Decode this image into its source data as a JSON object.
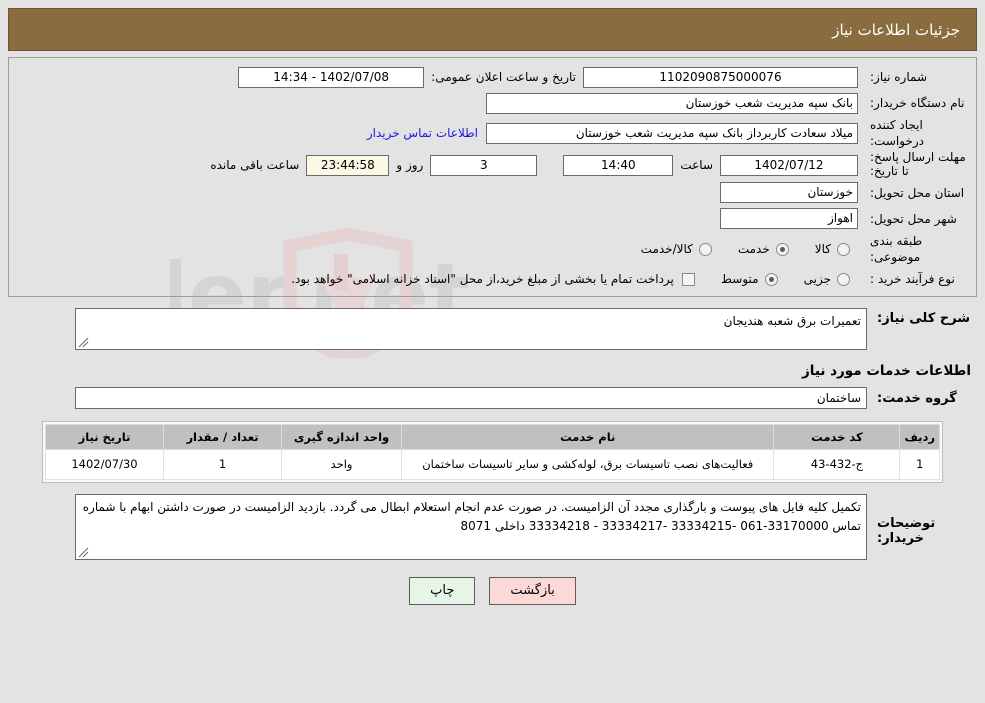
{
  "header": {
    "title": "جزئیات اطلاعات نیاز"
  },
  "form": {
    "need_number_label": "شماره نیاز:",
    "need_number_value": "1102090875000076",
    "public_announce_label": "تاریخ و ساعت اعلان عمومی:",
    "public_announce_value": "1402/07/08 - 14:34",
    "buyer_org_label": "نام دستگاه خریدار:",
    "buyer_org_value": "بانک سپه مدیریت شعب خوزستان",
    "creator_label": "ایجاد کننده درخواست:",
    "creator_value": "میلاد سعادت کاربرداز بانک سپه مدیریت شعب خوزستان",
    "buyer_contact_link": "اطلاعات تماس خریدار",
    "deadline_label": "مهلت ارسال پاسخ: تا تاریخ:",
    "deadline_date": "1402/07/12",
    "deadline_hour_label": "ساعت",
    "deadline_hour_value": "14:40",
    "remaining_days_value": "3",
    "remaining_days_text": "روز و",
    "remaining_time_value": "23:44:58",
    "remaining_suffix": "ساعت باقی مانده",
    "province_label": "استان محل تحویل:",
    "province_value": "خوزستان",
    "city_label": "شهر محل تحویل:",
    "city_value": "اهواز",
    "category_label": "طبقه بندی موضوعی:",
    "category_options": [
      {
        "label": "کالا",
        "selected": false
      },
      {
        "label": "خدمت",
        "selected": true
      },
      {
        "label": "کالا/خدمت",
        "selected": false
      }
    ],
    "process_label": "نوع فرآیند خرید :",
    "process_options": [
      {
        "label": "جزیی",
        "selected": false
      },
      {
        "label": "متوسط",
        "selected": true
      }
    ],
    "treasury_checkbox_checked": false,
    "treasury_note": "پرداخت تمام یا بخشی از مبلغ خرید،از محل \"اسناد خزانه اسلامی\" خواهد بود."
  },
  "description": {
    "label": "شرح کلی نیاز:",
    "value": "تعمیرات برق شعبه هندیجان"
  },
  "services": {
    "section_title": "اطلاعات خدمات مورد نیاز",
    "group_label": "گروه خدمت:",
    "group_value": "ساختمان",
    "columns": [
      "ردیف",
      "کد خدمت",
      "نام خدمت",
      "واحد اندازه گیری",
      "تعداد / مقدار",
      "تاریخ نیاز"
    ],
    "rows": [
      {
        "radif": "1",
        "code": "ج-432-43",
        "name": "فعالیت‌های نصب تاسیسات برق، لوله‌کشی و سایر تاسیسات ساختمان",
        "unit": "واحد",
        "qty": "1",
        "date": "1402/07/30"
      }
    ]
  },
  "buyer_notes": {
    "label": "توضیحات خریدار:",
    "value": "تکمیل کلیه فایل های پیوست و بارگذاری مجدد آن الزامیست. در صورت عدم انجام استعلام ابطال می گردد. بازدید الزامیست در صورت داشتن ابهام با شماره تماس 33170000-061 -33334215 -33334217 - 33334218 داخلی 8071"
  },
  "buttons": {
    "print": "چاپ",
    "back": "بازگشت"
  },
  "colors": {
    "header_bg": "#8a6d3f",
    "page_bg": "#e3e3e3",
    "link": "#1a1ae0",
    "table_header_bg": "#c0c0c0",
    "print_btn_bg": "#e6f5e6",
    "back_btn_bg": "#fbd9d9",
    "countdown_bg": "#fbf8e3"
  }
}
